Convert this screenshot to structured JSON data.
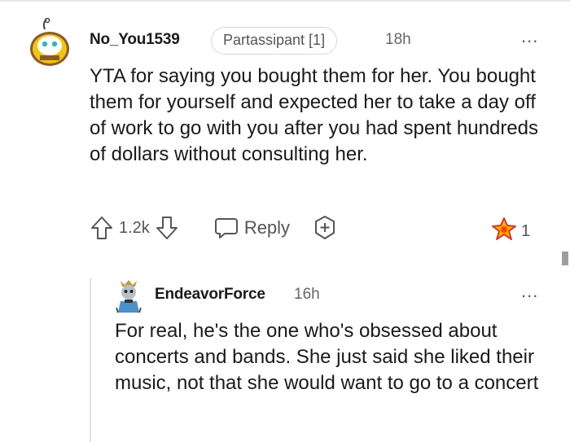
{
  "comment": {
    "author": "No_You1539",
    "flair": "Partassipant [1]",
    "time": "18h",
    "body": "YTA for saying you bought them for her. You bought them for yourself and expected her to take a day off of work to go with you after you had spent hundreds of dollars without consulting her.",
    "score": "1.2k",
    "reply_label": "Reply",
    "award_count": "1",
    "more_label": "..."
  },
  "reply": {
    "author": "EndeavorForce",
    "time": "16h",
    "body": "For real, he's the one who's obsessed about concerts and bands. She just said she liked their music, not that she would want to go to a concert",
    "more_label": "..."
  },
  "colors": {
    "text": "#1a1a1b",
    "meta": "#555555",
    "avatar1_primary": "#f0c419",
    "avatar2_primary": "#4a90c9"
  },
  "icons": [
    "upvote-icon",
    "downvote-icon",
    "reply-icon",
    "add-award-icon",
    "award-icon",
    "more-options-icon"
  ]
}
